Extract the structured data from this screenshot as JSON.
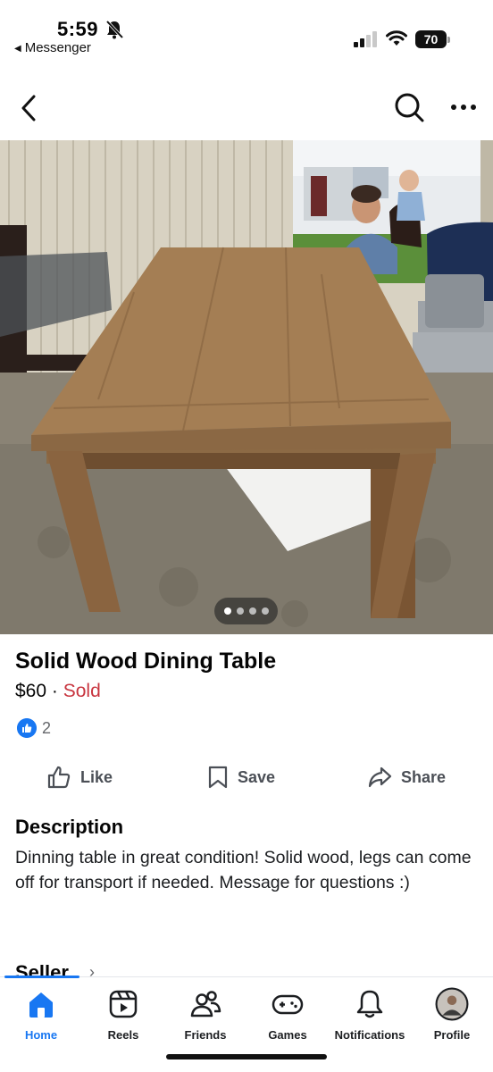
{
  "status_bar": {
    "time": "5:59",
    "back_app": "Messenger",
    "battery": "70"
  },
  "listing": {
    "title": "Solid Wood Dining Table",
    "price": "$60",
    "separator": " · ",
    "status": "Sold",
    "reaction_count": "2",
    "photo_count": 4,
    "current_photo": 1
  },
  "actions": {
    "like": "Like",
    "save": "Save",
    "share": "Share"
  },
  "description": {
    "heading": "Description",
    "body": "Dinning table in great condition! Solid wood, legs can come off for transport if needed. Message for questions :)"
  },
  "seller": {
    "heading": "Seller"
  },
  "tabs": [
    {
      "label": "Home",
      "icon": "home-icon",
      "active": true
    },
    {
      "label": "Reels",
      "icon": "reels-icon",
      "active": false
    },
    {
      "label": "Friends",
      "icon": "friends-icon",
      "active": false
    },
    {
      "label": "Games",
      "icon": "games-icon",
      "active": false
    },
    {
      "label": "Notifications",
      "icon": "bell-icon",
      "active": false
    },
    {
      "label": "Profile",
      "icon": "avatar",
      "active": false
    }
  ],
  "colors": {
    "accent": "#1877f2",
    "sold": "#c8353f"
  }
}
